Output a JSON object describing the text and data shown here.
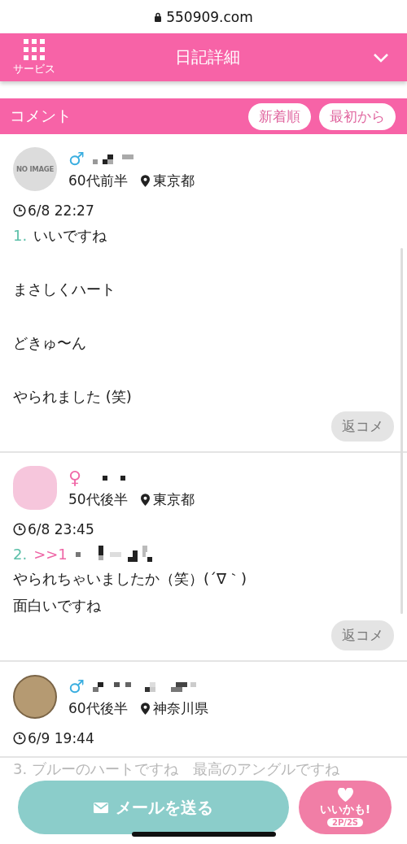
{
  "browser": {
    "url": "550909.com"
  },
  "header": {
    "menu_label": "サービス",
    "title": "日記詳細"
  },
  "comments_header": {
    "title": "コメント",
    "buttons": [
      "新着順",
      "最初から"
    ]
  },
  "comments": [
    {
      "avatar": {
        "kind": "no_image",
        "label": "NO IMAGE"
      },
      "gender": {
        "kind": "male",
        "symbol": "♂"
      },
      "age": "60代前半",
      "location": "東京都",
      "time": "6/8 22:27",
      "number": "1.",
      "spaced": true,
      "body": [
        "いいですね",
        "まさしくハート",
        "どきゅ〜ん",
        "やられました (笑)"
      ],
      "reply_button": "返コメ"
    },
    {
      "avatar": {
        "kind": "illustration"
      },
      "gender": {
        "kind": "female",
        "symbol": "♀"
      },
      "age": "50代後半",
      "location": "東京都",
      "time": "6/8 23:45",
      "number": "2.",
      "reply_to": ">>1",
      "spaced": false,
      "body": [
        "やられちゃいましたか（笑）(´∇｀)",
        "面白いですね"
      ],
      "reply_button": "返コメ"
    },
    {
      "avatar": {
        "kind": "illustration"
      },
      "gender": {
        "kind": "male",
        "symbol": "♂"
      },
      "age": "60代後半",
      "location": "神奈川県",
      "time": "6/9 19:44"
    }
  ],
  "faded_text": "3. ブルーのハートですね　最高のアングルですね",
  "footer": {
    "mail_button": "メールを送る",
    "like_button": "いいかも!",
    "like_cost": "2P/2S"
  }
}
